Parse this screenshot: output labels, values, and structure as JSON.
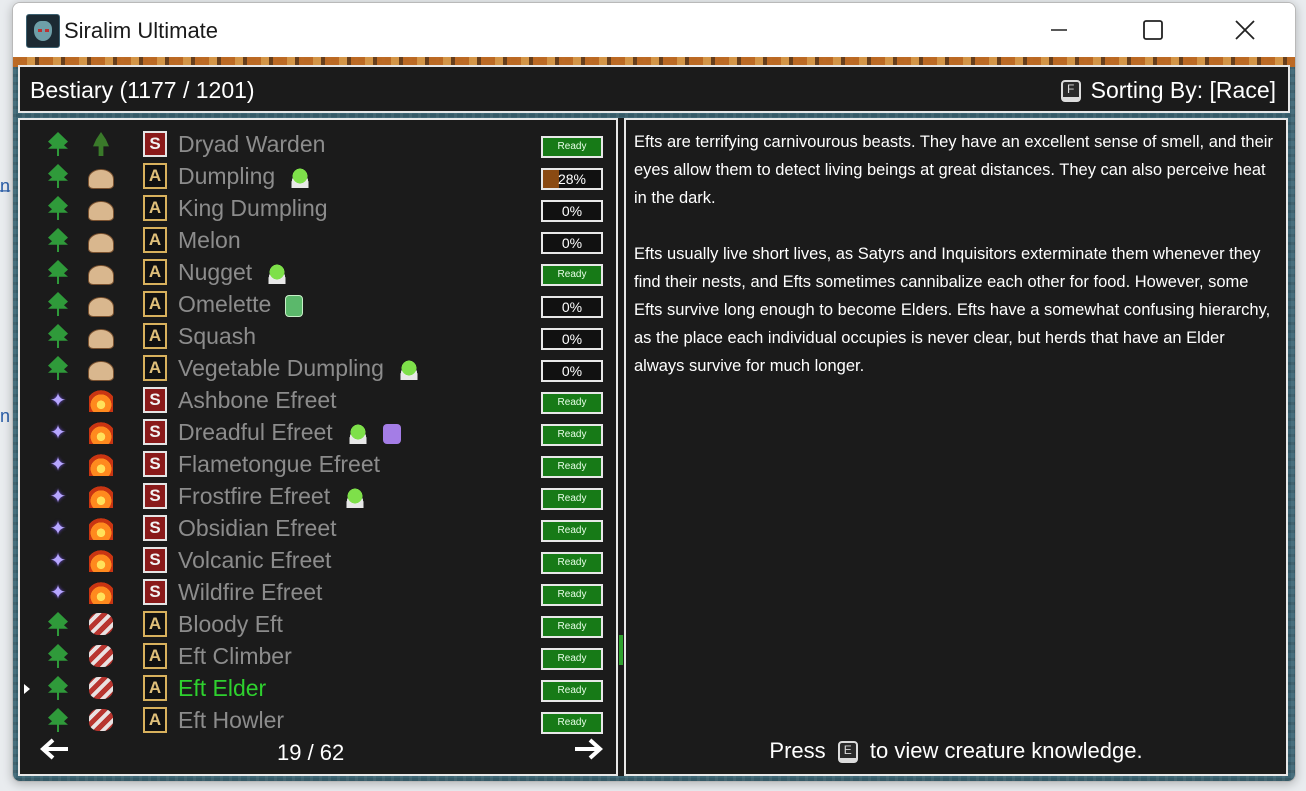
{
  "window": {
    "title": "Siralim Ultimate",
    "controls": {
      "minimize_icon": "minimize-icon",
      "maximize_icon": "maximize-icon",
      "close_icon": "close-icon"
    }
  },
  "header": {
    "title": "Bestiary (1177 / 1201)",
    "sort_key": "F",
    "sort_label": "Sorting By: [Race]"
  },
  "list": {
    "rows": [
      {
        "name": "Dryad Warden",
        "realm": "nature",
        "race": "dryad",
        "class": "S",
        "extras": [],
        "status": "Ready"
      },
      {
        "name": "Dumpling",
        "realm": "nature",
        "race": "dumpling",
        "class": "A",
        "extras": [
          "slime"
        ],
        "status": "28%"
      },
      {
        "name": "King Dumpling",
        "realm": "nature",
        "race": "dumpling",
        "class": "A",
        "extras": [],
        "status": "0%"
      },
      {
        "name": "Melon",
        "realm": "nature",
        "race": "dumpling",
        "class": "A",
        "extras": [],
        "status": "0%"
      },
      {
        "name": "Nugget",
        "realm": "nature",
        "race": "dumpling",
        "class": "A",
        "extras": [
          "slime"
        ],
        "status": "Ready"
      },
      {
        "name": "Omelette",
        "realm": "nature",
        "race": "dumpling",
        "class": "A",
        "extras": [
          "bottle"
        ],
        "status": "0%"
      },
      {
        "name": "Squash",
        "realm": "nature",
        "race": "dumpling",
        "class": "A",
        "extras": [],
        "status": "0%"
      },
      {
        "name": "Vegetable Dumpling",
        "realm": "nature",
        "race": "dumpling",
        "class": "A",
        "extras": [
          "slime"
        ],
        "status": "0%"
      },
      {
        "name": "Ashbone Efreet",
        "realm": "sorcery",
        "race": "efreet",
        "class": "S",
        "extras": [],
        "status": "Ready"
      },
      {
        "name": "Dreadful Efreet",
        "realm": "sorcery",
        "race": "efreet",
        "class": "S",
        "extras": [
          "slime",
          "ghost"
        ],
        "status": "Ready"
      },
      {
        "name": "Flametongue Efreet",
        "realm": "sorcery",
        "race": "efreet",
        "class": "S",
        "extras": [],
        "status": "Ready"
      },
      {
        "name": "Frostfire Efreet",
        "realm": "sorcery",
        "race": "efreet",
        "class": "S",
        "extras": [
          "slime"
        ],
        "status": "Ready"
      },
      {
        "name": "Obsidian Efreet",
        "realm": "sorcery",
        "race": "efreet",
        "class": "S",
        "extras": [],
        "status": "Ready"
      },
      {
        "name": "Volcanic Efreet",
        "realm": "sorcery",
        "race": "efreet",
        "class": "S",
        "extras": [],
        "status": "Ready"
      },
      {
        "name": "Wildfire Efreet",
        "realm": "sorcery",
        "race": "efreet",
        "class": "S",
        "extras": [],
        "status": "Ready"
      },
      {
        "name": "Bloody Eft",
        "realm": "nature",
        "race": "eft",
        "class": "A",
        "extras": [],
        "status": "Ready"
      },
      {
        "name": "Eft Climber",
        "realm": "nature",
        "race": "eft",
        "class": "A",
        "extras": [],
        "status": "Ready"
      },
      {
        "name": "Eft Elder",
        "realm": "nature",
        "race": "eft",
        "class": "A",
        "extras": [],
        "status": "Ready",
        "selected": true
      },
      {
        "name": "Eft Howler",
        "realm": "nature",
        "race": "eft",
        "class": "A",
        "extras": [],
        "status": "Ready"
      }
    ],
    "progress_fill": {
      "Dumpling": 0.28
    },
    "pager": "19 / 62",
    "prev_icon": "arrow-left-icon",
    "next_icon": "arrow-right-icon"
  },
  "description": {
    "paragraphs": [
      "Efts are terrifying carnivourous beasts. They have an excellent sense of smell, and their eyes allow them to detect living beings at great distances. They can also perceive heat in the dark.",
      "Efts usually live short lives, as Satyrs and Inquisitors exterminate them whenever they find their nests, and Efts sometimes cannibalize each other for food. However, some Efts survive long enough to become Elders. Efts have a somewhat confusing hierarchy, as the place each individual occupies is never clear, but herds that have an Elder always survive for much longer."
    ],
    "prompt_before": "Press",
    "prompt_key": "E",
    "prompt_after": "to view creature knowledge."
  },
  "colors": {
    "selected": "#2ed12e",
    "ready_bg": "#177a17",
    "text_dim": "#8c8c8c",
    "progress_fill": "#8a4a12"
  }
}
